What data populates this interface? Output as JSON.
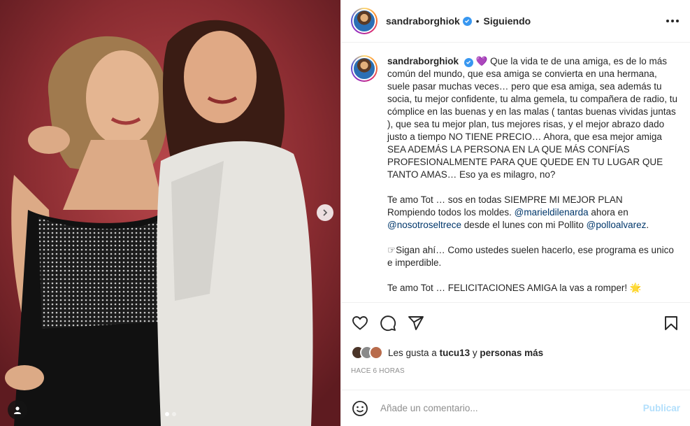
{
  "post": {
    "username": "sandraborghiok",
    "separator": "•",
    "follow_status": "Siguiendo"
  },
  "caption": {
    "username": "sandraborghiok",
    "heart": "💜",
    "paragraph1": "Que la vida te de una amiga, es de lo más común del mundo, que esa amiga se convierta en una hermana, suele pasar muchas veces… pero que esa amiga, sea además tu socia, tu mejor confidente, tu alma gemela, tu compañera de radio, tu cómplice en las buenas y en las malas ( tantas buenas vividas juntas ), que sea tu mejor plan, tus mejores risas, y el mejor abrazo dado justo a tiempo NO TIENE PRECIO… Ahora, que esa mejor amiga SEA ADEMÁS LA PERSONA EN LA QUE MÁS CONFÍAS PROFESIONALMENTE PARA QUE QUEDE EN TU LUGAR QUE TANTO AMAS… Eso ya es milagro, no?",
    "p2_line1": "Te amo Tot … sos en todas SIEMPRE MI MEJOR PLAN",
    "p2_line2_pre": "Rompiendo todos los moldes.",
    "mention1": "@marieldilenarda",
    "p2_line2_post": "ahora en",
    "mention2": "@nosotroseltrece",
    "p2_line3_mid": "desde el lunes con mi Pollito",
    "mention3": "@polloalvarez",
    "p2_end": ".",
    "paragraph3": "☞Sigan ahí… Como ustedes suelen hacerlo, ese programa es unico e imperdible.",
    "paragraph4": "Te amo Tot … FELICITACIONES AMIGA la vas a romper! 🌟"
  },
  "likes": {
    "prefix": "Les gusta a",
    "user": "tucu13",
    "connector": "y",
    "others": "personas más"
  },
  "timestamp": "HACE 6 HORAS",
  "comment": {
    "placeholder": "Añade un comentario...",
    "publish_label": "Publicar"
  },
  "carousel": {
    "total": 2,
    "current": 1
  },
  "colors": {
    "mention": "#00376b",
    "verified": "#3897f0",
    "publish_disabled": "#b2dffc"
  }
}
